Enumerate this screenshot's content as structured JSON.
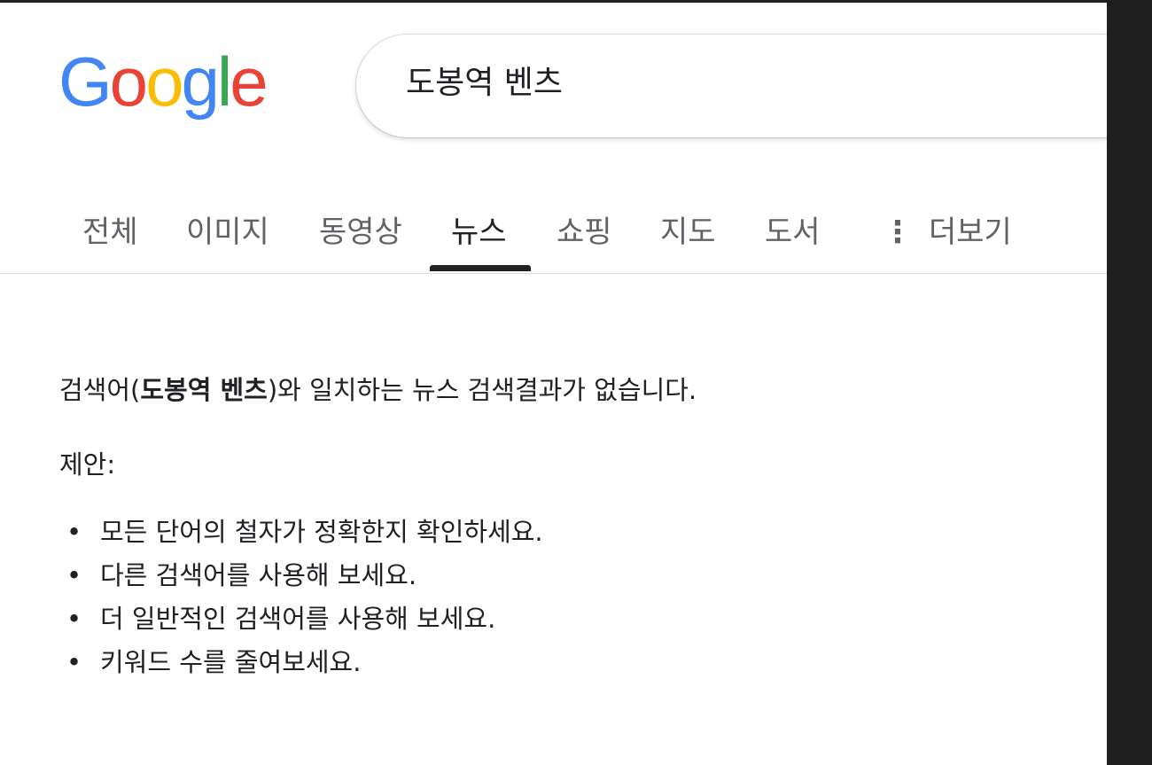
{
  "logo": {
    "letters": [
      {
        "char": "G",
        "color": "#4285F4"
      },
      {
        "char": "o",
        "color": "#EA4335"
      },
      {
        "char": "o",
        "color": "#FBBC05"
      },
      {
        "char": "g",
        "color": "#4285F4"
      },
      {
        "char": "l",
        "color": "#34A853"
      },
      {
        "char": "e",
        "color": "#EA4335"
      }
    ]
  },
  "search": {
    "value": "도봉역 벤츠"
  },
  "tabs": {
    "all": "전체",
    "images": "이미지",
    "videos": "동영상",
    "news": "뉴스",
    "shopping": "쇼핑",
    "maps": "지도",
    "books": "도서",
    "more": "더보기",
    "more_icon": "⋮",
    "active": "news"
  },
  "results": {
    "no_result_prefix": "검색어(",
    "query_bold": "도봉역 벤츠",
    "no_result_suffix": ")와 일치하는 뉴스 검색결과가 없습니다.",
    "suggestions_label": "제안:",
    "suggestions": [
      "모든 단어의 철자가 정확한지 확인하세요.",
      "다른 검색어를 사용해 보세요.",
      "더 일반적인 검색어를 사용해 보세요.",
      "키워드 수를 줄여보세요."
    ],
    "bullet": "•"
  },
  "colors": {
    "active_tab": "#202124",
    "inactive_tab": "#5f6368",
    "right_panel": "#1f1f1f"
  }
}
